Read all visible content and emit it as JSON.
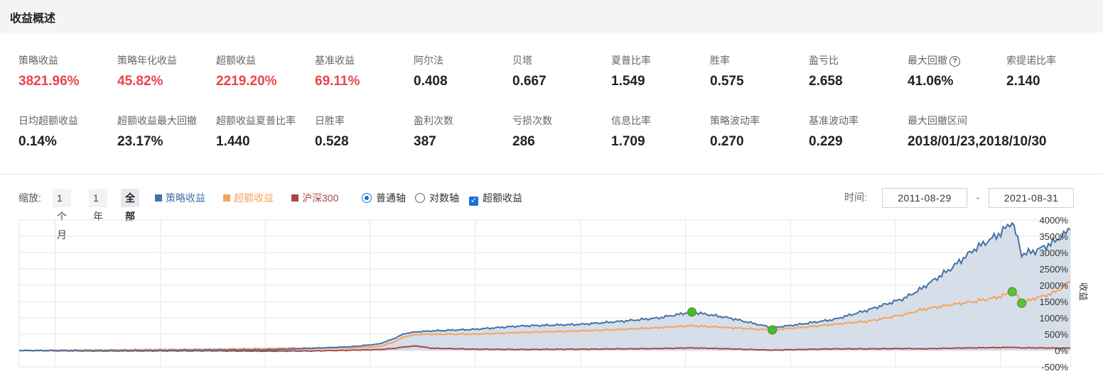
{
  "header": {
    "title": "收益概述"
  },
  "metrics": [
    {
      "label": "策略收益",
      "value": "3821.96%",
      "color": "#e8464a"
    },
    {
      "label": "策略年化收益",
      "value": "45.82%",
      "color": "#e8464a"
    },
    {
      "label": "超额收益",
      "value": "2219.20%",
      "color": "#e8464a"
    },
    {
      "label": "基准收益",
      "value": "69.11%",
      "color": "#e8464a"
    },
    {
      "label": "阿尔法",
      "value": "0.408"
    },
    {
      "label": "贝塔",
      "value": "0.667"
    },
    {
      "label": "夏普比率",
      "value": "1.549"
    },
    {
      "label": "胜率",
      "value": "0.575"
    },
    {
      "label": "盈亏比",
      "value": "2.658"
    },
    {
      "label": "最大回撤",
      "value": "41.06%",
      "help_icon": "question-circle-icon"
    },
    {
      "label": "索提诺比率",
      "value": "2.140"
    },
    {
      "label": "日均超额收益",
      "value": "0.14%"
    },
    {
      "label": "超额收益最大回撤",
      "value": "23.17%"
    },
    {
      "label": "超额收益夏普比率",
      "value": "1.440"
    },
    {
      "label": "日胜率",
      "value": "0.528"
    },
    {
      "label": "盈利次数",
      "value": "387"
    },
    {
      "label": "亏损次数",
      "value": "286"
    },
    {
      "label": "信息比率",
      "value": "1.709"
    },
    {
      "label": "策略波动率",
      "value": "0.270"
    },
    {
      "label": "基准波动率",
      "value": "0.229"
    },
    {
      "label": "最大回撤区间",
      "value": "2018/01/23,2018/10/30"
    }
  ],
  "toolbar": {
    "zoom_label": "缩放:",
    "zoom_options": [
      "1个月",
      "1年",
      "全部"
    ],
    "zoom_selected": "全部",
    "legend": [
      {
        "name": "策略收益",
        "color": "#4572a7"
      },
      {
        "name": "超额收益",
        "color": "#f7a35c"
      },
      {
        "name": "沪深300",
        "color": "#aa4643"
      }
    ],
    "axis_modes": [
      "普通轴",
      "对数轴"
    ],
    "axis_selected": "普通轴",
    "excess_checkbox": {
      "label": "超额收益",
      "checked": true
    },
    "time_label": "时间:",
    "start_date": "2011-08-29",
    "date_separator": "-",
    "end_date": "2021-08-31"
  },
  "chart_data": {
    "type": "line",
    "x_range": [
      "2011-08-29",
      "2021-08-31"
    ],
    "ylabel": "收益",
    "ylim": [
      -500,
      4000
    ],
    "y_ticks": [
      "4000%",
      "3500%",
      "3000%",
      "2500%",
      "2000%",
      "1500%",
      "1000%",
      "500%",
      "0%",
      "-500%"
    ],
    "grid": true,
    "series": [
      {
        "name": "策略收益",
        "color": "#4572a7",
        "fill": "#d4dce8",
        "x": [
          "2011-08-29",
          "2012-06-01",
          "2013-06-01",
          "2014-01-01",
          "2014-06-01",
          "2014-11-01",
          "2015-02-01",
          "2015-03-20",
          "2015-05-01",
          "2015-06-10",
          "2015-08-01",
          "2016-01-01",
          "2016-06-01",
          "2017-01-01",
          "2017-06-01",
          "2017-10-01",
          "2018-01-23",
          "2018-06-01",
          "2018-10-30",
          "2019-02-01",
          "2019-06-01",
          "2019-10-01",
          "2020-02-01",
          "2020-04-01",
          "2020-07-10",
          "2020-10-01",
          "2021-01-01",
          "2021-02-10",
          "2021-03-01",
          "2021-03-15",
          "2021-05-01",
          "2021-07-01",
          "2021-08-31"
        ],
        "values": [
          0,
          -10,
          10,
          20,
          60,
          120,
          200,
          350,
          520,
          570,
          600,
          650,
          750,
          800,
          900,
          1000,
          1180,
          1000,
          700,
          800,
          950,
          1250,
          1600,
          1900,
          2500,
          3100,
          3600,
          3950,
          3400,
          2950,
          3050,
          3300,
          3700
        ]
      },
      {
        "name": "超额收益",
        "color": "#f7a35c",
        "x": [
          "2011-08-29",
          "2012-06-01",
          "2013-06-01",
          "2014-01-01",
          "2014-06-01",
          "2014-11-01",
          "2015-02-01",
          "2015-03-20",
          "2015-05-01",
          "2015-06-10",
          "2015-08-01",
          "2016-01-01",
          "2016-06-01",
          "2017-01-01",
          "2017-06-01",
          "2017-10-01",
          "2018-01-23",
          "2018-06-01",
          "2018-10-30",
          "2019-02-01",
          "2019-06-01",
          "2019-10-01",
          "2020-02-01",
          "2020-04-01",
          "2020-07-10",
          "2020-10-01",
          "2021-01-01",
          "2021-02-10",
          "2021-03-01",
          "2021-03-15",
          "2021-05-01",
          "2021-07-01",
          "2021-08-31"
        ],
        "values": [
          0,
          20,
          40,
          60,
          80,
          80,
          120,
          250,
          420,
          490,
          500,
          500,
          550,
          600,
          650,
          700,
          760,
          700,
          630,
          700,
          800,
          900,
          1100,
          1250,
          1400,
          1500,
          1650,
          1800,
          1650,
          1450,
          1600,
          1750,
          2100
        ]
      },
      {
        "name": "沪深300",
        "color": "#aa4643",
        "x": [
          "2011-08-29",
          "2012-06-01",
          "2013-06-01",
          "2014-01-01",
          "2014-06-01",
          "2014-11-01",
          "2015-02-01",
          "2015-03-20",
          "2015-05-01",
          "2015-06-10",
          "2015-08-01",
          "2016-01-01",
          "2016-06-01",
          "2017-01-01",
          "2017-06-01",
          "2017-10-01",
          "2018-01-23",
          "2018-06-01",
          "2018-10-30",
          "2019-02-01",
          "2019-06-01",
          "2019-10-01",
          "2020-02-01",
          "2020-04-01",
          "2020-07-10",
          "2020-10-01",
          "2021-01-01",
          "2021-02-10",
          "2021-03-01",
          "2021-03-15",
          "2021-05-01",
          "2021-07-01",
          "2021-08-31"
        ],
        "values": [
          0,
          -15,
          -10,
          -20,
          -15,
          10,
          30,
          60,
          110,
          140,
          70,
          40,
          30,
          40,
          50,
          60,
          80,
          50,
          10,
          30,
          50,
          50,
          60,
          50,
          70,
          80,
          90,
          100,
          85,
          80,
          80,
          75,
          69
        ]
      }
    ],
    "markers": [
      {
        "series": "策略收益",
        "x": "2018-01-23",
        "y": 1180,
        "color": "#4ab82e"
      },
      {
        "series": "超额收益",
        "x": "2018-10-30",
        "y": 630,
        "color": "#4ab82e"
      },
      {
        "series": "超额收益",
        "x": "2021-02-10",
        "y": 1800,
        "color": "#5ec234"
      },
      {
        "series": "超额收益",
        "x": "2021-03-15",
        "y": 1450,
        "color": "#5ec234"
      }
    ]
  }
}
